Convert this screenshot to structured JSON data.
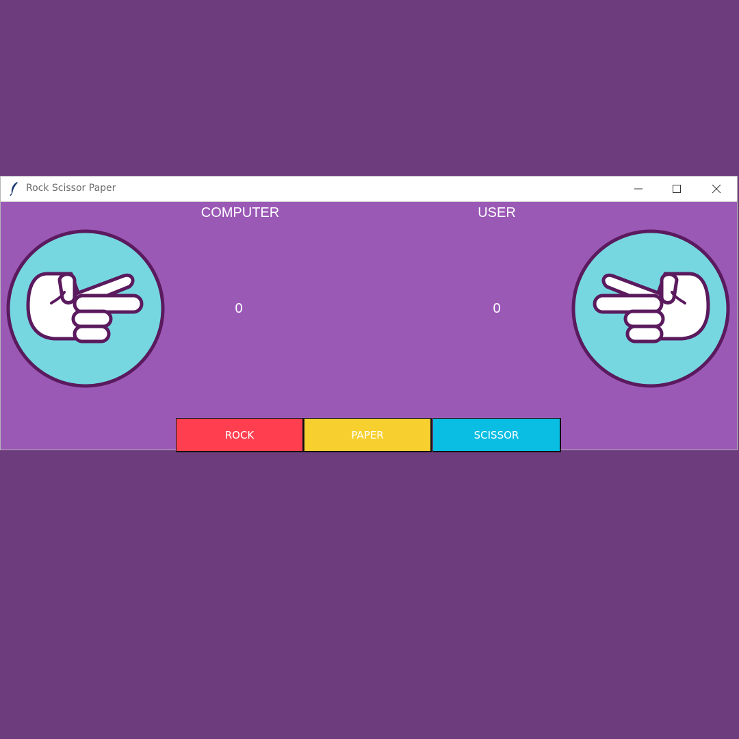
{
  "window": {
    "title": "Rock Scissor Paper",
    "controls": {
      "minimize": "minimize-icon",
      "maximize": "maximize-icon",
      "close": "close-icon"
    }
  },
  "colors": {
    "background": "#6d3c7c",
    "panel": "#9b59b6",
    "circle_fill": "#76d7e0",
    "circle_border": "#5b1a5e",
    "rock_button": "#ff3f4f",
    "paper_button": "#f7d030",
    "scissor_button": "#0abde3"
  },
  "game": {
    "computer_label": "COMPUTER",
    "user_label": "USER",
    "computer_score": "0",
    "user_score": "0",
    "computer_hand_icon": "scissor-hand-icon",
    "user_hand_icon": "scissor-hand-icon"
  },
  "buttons": {
    "rock": "ROCK",
    "paper": "PAPER",
    "scissor": "SCISSOR"
  }
}
